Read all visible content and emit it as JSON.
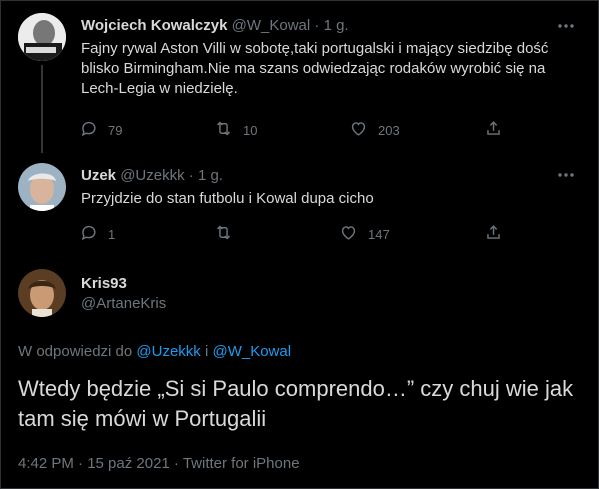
{
  "tweets": [
    {
      "name": "Wojciech Kowalczyk",
      "handle": "@W_Kowal",
      "time": "1 g.",
      "text": "Fajny rywal Aston Villi w sobotę,taki portugalski i mający siedzibę dość blisko Birmingham.Nie ma szans odwiedzając rodaków wyrobić się na Lech-Legia w niedzielę.",
      "replies": "79",
      "retweets": "10",
      "likes": "203"
    },
    {
      "name": "Uzek",
      "handle": "@Uzekkk",
      "time": "1 g.",
      "text": "Przyjdzie do stan futbolu i Kowal dupa cicho",
      "replies": "1",
      "retweets": "",
      "likes": "147"
    }
  ],
  "main": {
    "name": "Kris93",
    "handle": "@ArtaneKris",
    "replying_prefix": "W odpowiedzi do ",
    "replying_user1": "@Uzekkk",
    "replying_joiner": " i ",
    "replying_user2": "@W_Kowal",
    "text": "Wtedy będzie „Si si Paulo comprendo…” czy chuj wie jak tam się mówi w Portugalii",
    "footer": "4:42 PM · 15 paź 2021 · Twitter for iPhone"
  },
  "icons": {
    "more": "more-horizontal-icon",
    "reply": "reply-bubble-icon",
    "retweet": "retweet-icon",
    "like": "heart-icon",
    "share": "share-icon"
  },
  "colors": {
    "background": "#000000",
    "link": "#1d9bf0",
    "muted": "#6e767d",
    "text": "#d9d9d9"
  }
}
